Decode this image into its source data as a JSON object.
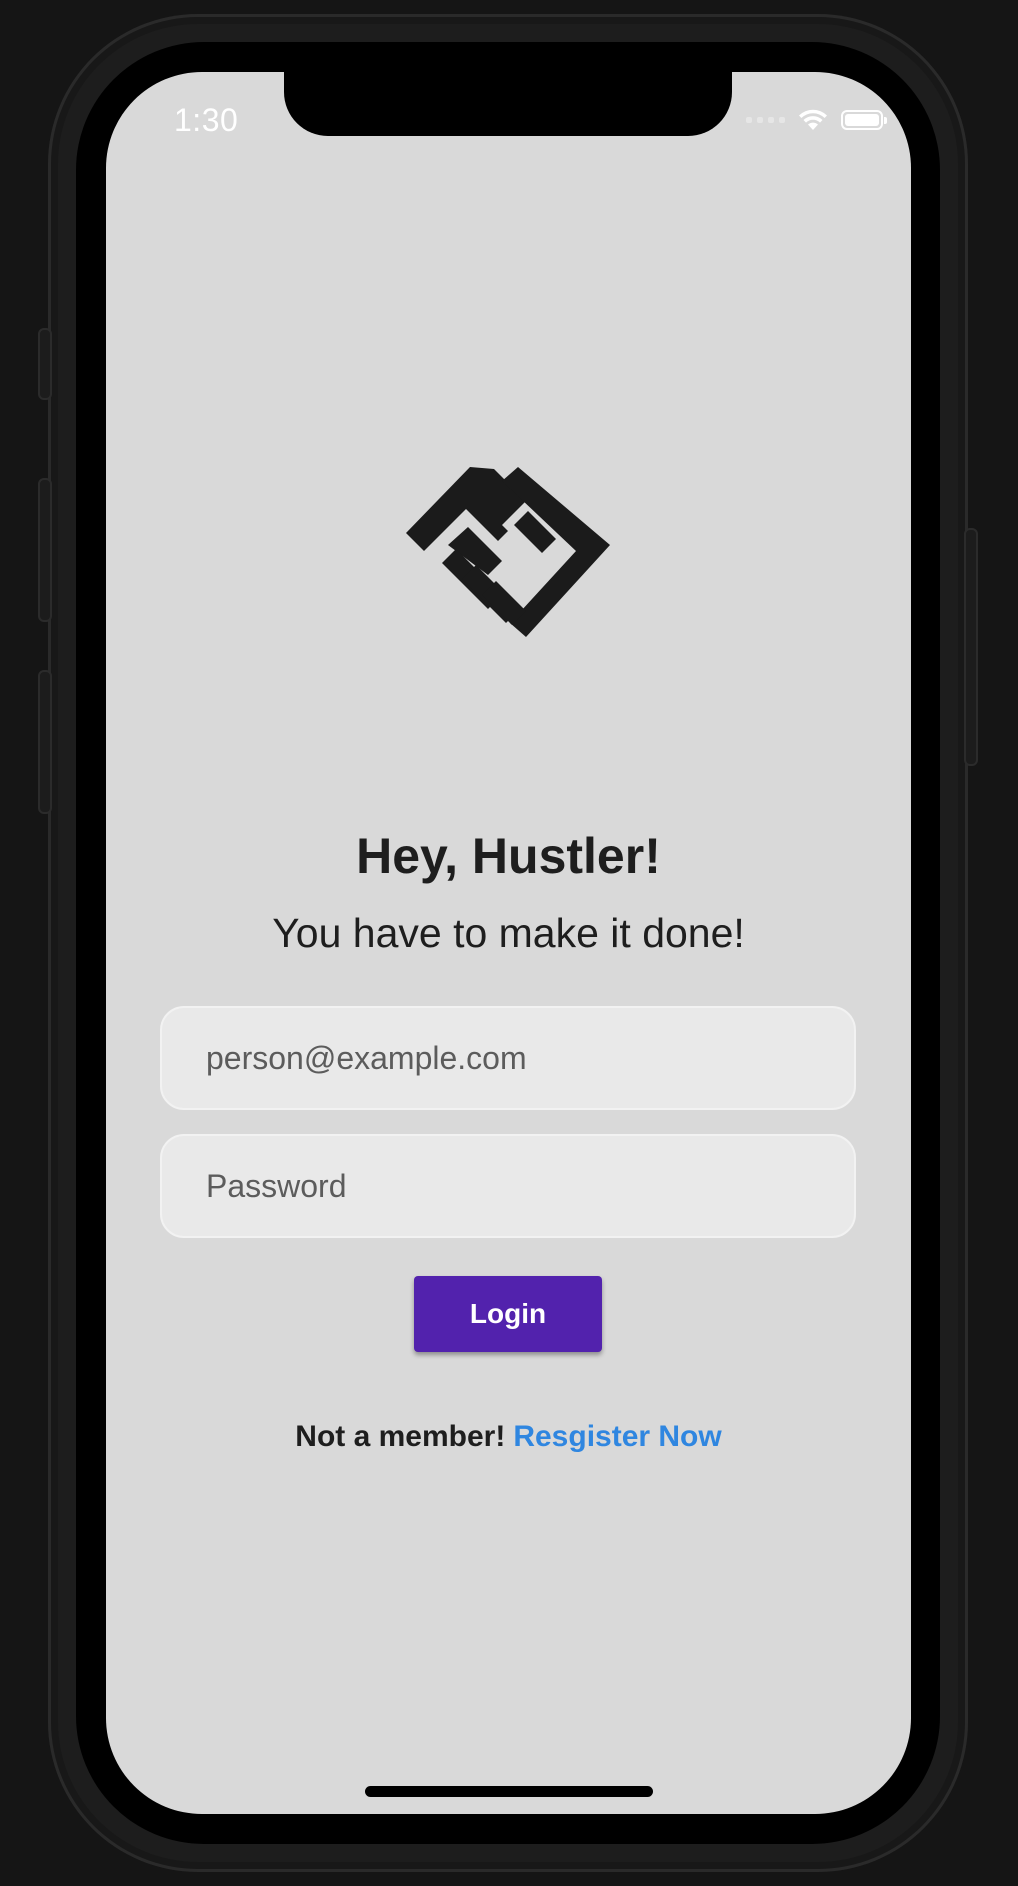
{
  "status_bar": {
    "time": "1:30",
    "icons": [
      "cellular-signal-icon",
      "wifi-icon",
      "battery-icon"
    ]
  },
  "logo": {
    "icon": "handshake-logo-icon"
  },
  "heading": "Hey, Hustler!",
  "subheading": "You have to make it done!",
  "email": {
    "placeholder": "person@example.com",
    "value": ""
  },
  "password": {
    "placeholder": "Password",
    "value": ""
  },
  "login_button": "Login",
  "register": {
    "prompt": "Not a member!",
    "link": "Resgister Now"
  },
  "colors": {
    "primary": "#5222ad",
    "link": "#2f86e0",
    "screen_background": "#d9d9d9",
    "text": "#1e1e1e"
  }
}
